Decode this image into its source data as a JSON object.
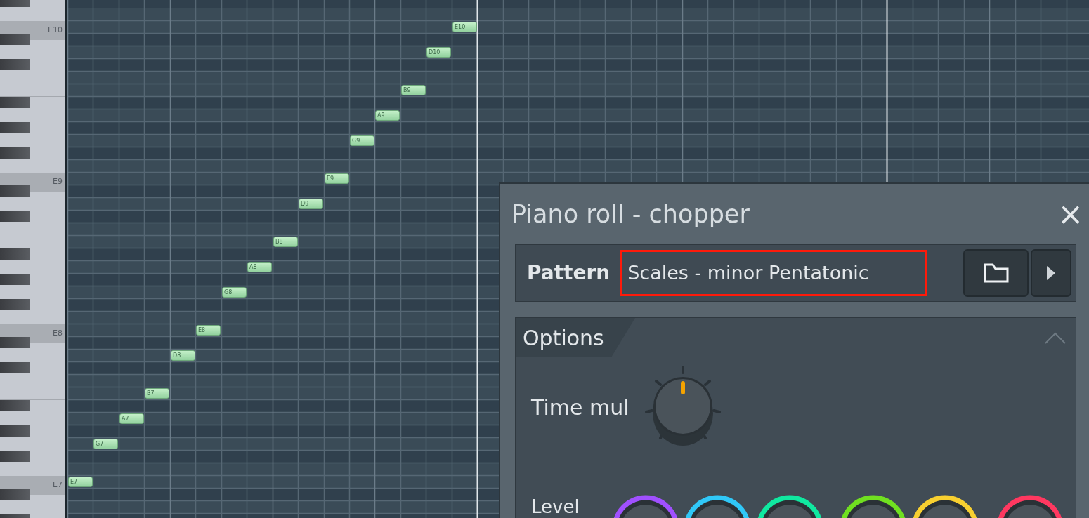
{
  "keyboard": {
    "labels": [
      "E10",
      "E9",
      "E8",
      "E7"
    ]
  },
  "notes": [
    {
      "label": "E7"
    },
    {
      "label": "G7"
    },
    {
      "label": "A7"
    },
    {
      "label": "B7"
    },
    {
      "label": "D8"
    },
    {
      "label": "E8"
    },
    {
      "label": "G8"
    },
    {
      "label": "A8"
    },
    {
      "label": "B8"
    },
    {
      "label": "D9"
    },
    {
      "label": "E9"
    },
    {
      "label": "G9"
    },
    {
      "label": "A9"
    },
    {
      "label": "B9"
    },
    {
      "label": "D10"
    },
    {
      "label": "E10"
    }
  ],
  "dialog": {
    "title": "Piano roll - chopper",
    "close": "×",
    "pattern": {
      "label": "Pattern",
      "value": "Scales - minor Pentatonic",
      "highlighted": true
    },
    "options": {
      "title": "Options",
      "expanded": true,
      "time_mul": {
        "label": "Time mul"
      },
      "level": {
        "label": "Level"
      },
      "level_knobs": [
        {
          "color": "#a050ff"
        },
        {
          "color": "#30c8f8"
        },
        {
          "color": "#10e8a0"
        },
        {
          "color": "#70e020"
        },
        {
          "color": "#f8d030"
        },
        {
          "color": "#ff3860"
        }
      ]
    }
  }
}
